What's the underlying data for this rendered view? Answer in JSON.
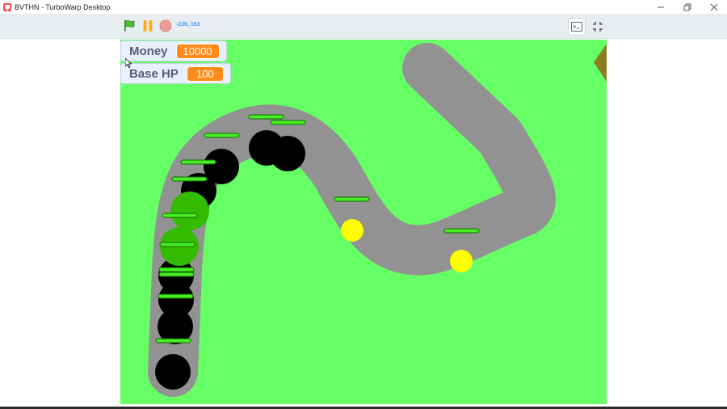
{
  "window": {
    "title": "BVTHN - TurboWarp Desktop"
  },
  "toolbar": {
    "coords": "-236, 163"
  },
  "monitors": {
    "money": {
      "label": "Money",
      "value": "10000"
    },
    "base_hp": {
      "label": "Base HP",
      "value": "100"
    }
  },
  "colors": {
    "grass": "#66ff66",
    "path": "#929292",
    "enemy_black": "#000000",
    "enemy_green": "#33bb00",
    "enemy_yellow": "#ffff00",
    "health_bar": "#44ee22",
    "monitor_value": "#ff8c1a"
  },
  "icons": [
    "green-flag-icon",
    "pause-icon",
    "stop-icon",
    "console-icon",
    "fullscreen-icon"
  ]
}
